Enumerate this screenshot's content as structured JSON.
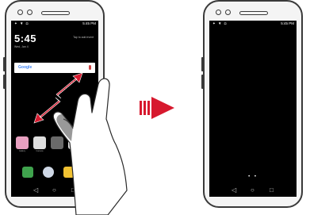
{
  "left_phone": {
    "status_time": "5:45 PM",
    "clock": "5:45",
    "date": "Wed, Jan 4",
    "tap_hint": "Tap to add event",
    "search_bar_label": "Google",
    "apps": [
      {
        "label": "Gallery",
        "color": "#e8a0c0"
      },
      {
        "label": "Camera",
        "color": "#dddddd"
      },
      {
        "label": "",
        "color": "#6a6a6a"
      },
      {
        "label": "Play Store",
        "color": "#eaeaea"
      },
      {
        "label": "",
        "color": "#90c8e8"
      }
    ]
  },
  "right_phone": {
    "status_time": "5:45 PM"
  },
  "transition_arrow_color": "#d7192e",
  "gesture_arrow_color": "#d7192e",
  "nav_buttons": {
    "back": "◁",
    "home": "○",
    "recents": "□"
  },
  "pager_dots": "• •"
}
